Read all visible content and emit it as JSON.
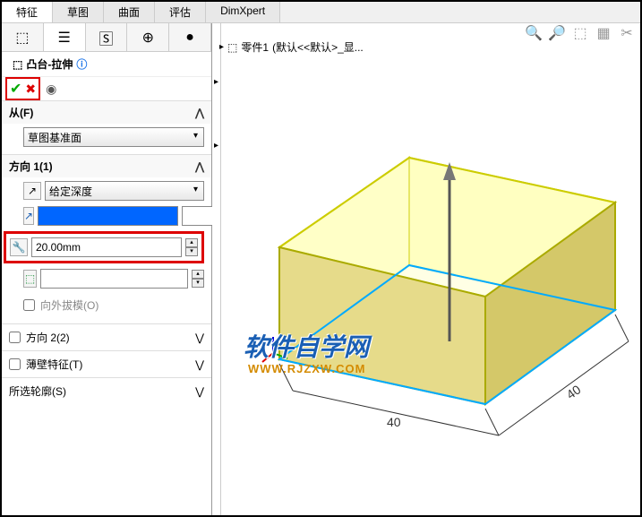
{
  "tabs": [
    "特征",
    "草图",
    "曲面",
    "评估",
    "DimXpert"
  ],
  "breadcrumb": {
    "part": "零件1",
    "config": "(默认<<默认>_显..."
  },
  "feature": {
    "title": "凸台-拉伸",
    "from_label": "从(F)",
    "from_option": "草图基准面",
    "dir1_label": "方向 1(1)",
    "dir1_option": "给定深度",
    "depth_value": "20.00mm",
    "draft_label": "向外拔模(O)",
    "dir2_label": "方向 2(2)",
    "thin_label": "薄壁特征(T)",
    "contour_label": "所选轮廓(S)"
  },
  "watermark": {
    "text": "软件自学网",
    "url": "WWW.RJZXW.COM"
  },
  "chart_data": {
    "type": "3d-box",
    "dimensions": {
      "width": 40,
      "depth": 40,
      "height": 20
    },
    "units": "mm"
  }
}
